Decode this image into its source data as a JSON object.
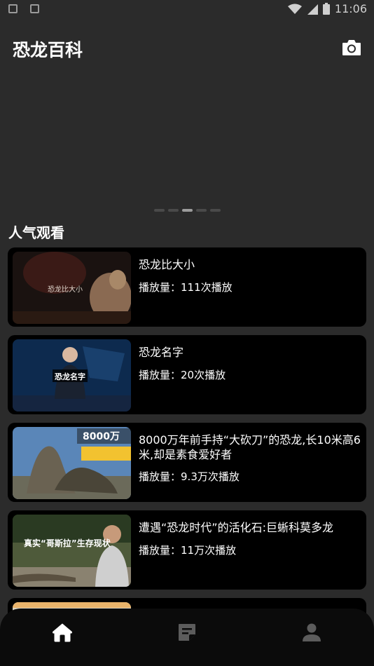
{
  "status_bar": {
    "time": "11:06"
  },
  "header": {
    "title": "恐龙百科",
    "camera_icon": "camera-icon"
  },
  "banner": {
    "page_count": 5,
    "active_page": 3
  },
  "section": {
    "title": "人气观看"
  },
  "videos": [
    {
      "title": "恐龙比大小",
      "meta_label": "播放量：",
      "plays": "111次播放",
      "thumb_caption": "恐龙比大小"
    },
    {
      "title": "恐龙名字",
      "meta_label": "播放量：",
      "plays": "20次播放",
      "thumb_caption": "恐龙名字"
    },
    {
      "title": "8000万年前手持“大砍刀”的恐龙,长10米高6米,却是素食爱好者",
      "meta_label": "播放量：",
      "plays": "9.3万次播放",
      "thumb_caption": "8000万"
    },
    {
      "title": "遭遇“恐龙时代”的活化石:巨蜥科莫多龙",
      "meta_label": "播放量：",
      "plays": "11万次播放",
      "thumb_caption": "真实“哥斯拉”生存现状"
    }
  ],
  "bottom_nav": [
    {
      "name": "home",
      "icon": "home-icon",
      "active": true
    },
    {
      "name": "notes",
      "icon": "notes-icon",
      "active": false
    },
    {
      "name": "profile",
      "icon": "person-icon",
      "active": false
    }
  ]
}
